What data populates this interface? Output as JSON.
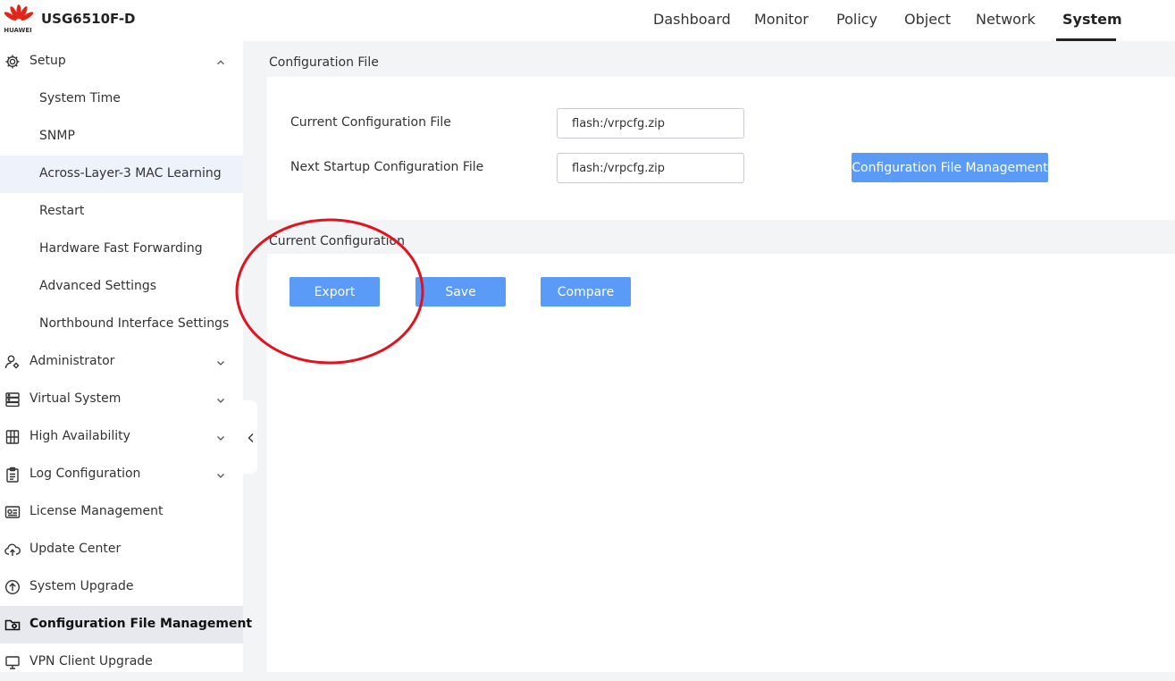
{
  "header": {
    "brand_logo_text": "HUAWEI",
    "device_name": "USG6510F-D",
    "nav": [
      "Dashboard",
      "Monitor",
      "Policy",
      "Object",
      "Network",
      "System"
    ],
    "active_nav": "System"
  },
  "sidebar": {
    "setup": {
      "label": "Setup",
      "icon": "gear-icon",
      "expanded": true
    },
    "setup_children": [
      "System Time",
      "SNMP",
      "Across-Layer-3 MAC Learning",
      "Restart",
      "Hardware Fast Forwarding",
      "Advanced Settings",
      "Northbound Interface Settings"
    ],
    "items": [
      {
        "label": "Administrator",
        "icon": "admin-user-icon",
        "expandable": true
      },
      {
        "label": "Virtual System",
        "icon": "server-icon",
        "expandable": true
      },
      {
        "label": "High Availability",
        "icon": "high-availability-icon",
        "expandable": true
      },
      {
        "label": "Log Configuration",
        "icon": "clipboard-icon",
        "expandable": true
      },
      {
        "label": "License Management",
        "icon": "license-icon",
        "expandable": false
      },
      {
        "label": "Update Center",
        "icon": "cloud-upload-icon",
        "expandable": false
      },
      {
        "label": "System Upgrade",
        "icon": "upgrade-icon",
        "expandable": false
      },
      {
        "label": "Configuration File Management",
        "icon": "config-file-icon",
        "expandable": false
      },
      {
        "label": "VPN Client Upgrade",
        "icon": "vpn-icon",
        "expandable": false
      }
    ],
    "selected": "Configuration File Management"
  },
  "config_file": {
    "title": "Configuration File",
    "current_label": "Current Configuration File",
    "current_value": "flash:/vrpcfg.zip",
    "next_label": "Next Startup Configuration File",
    "next_value": "flash:/vrpcfg.zip",
    "management_button": "Configuration File Management"
  },
  "current_config": {
    "title": "Current Configuration",
    "export_button": "Export",
    "save_button": "Save",
    "compare_button": "Compare"
  },
  "colors": {
    "primary_button": "#5b9bf8",
    "annotation_circle": "#e0141e",
    "brand_red": "#e1251b"
  }
}
